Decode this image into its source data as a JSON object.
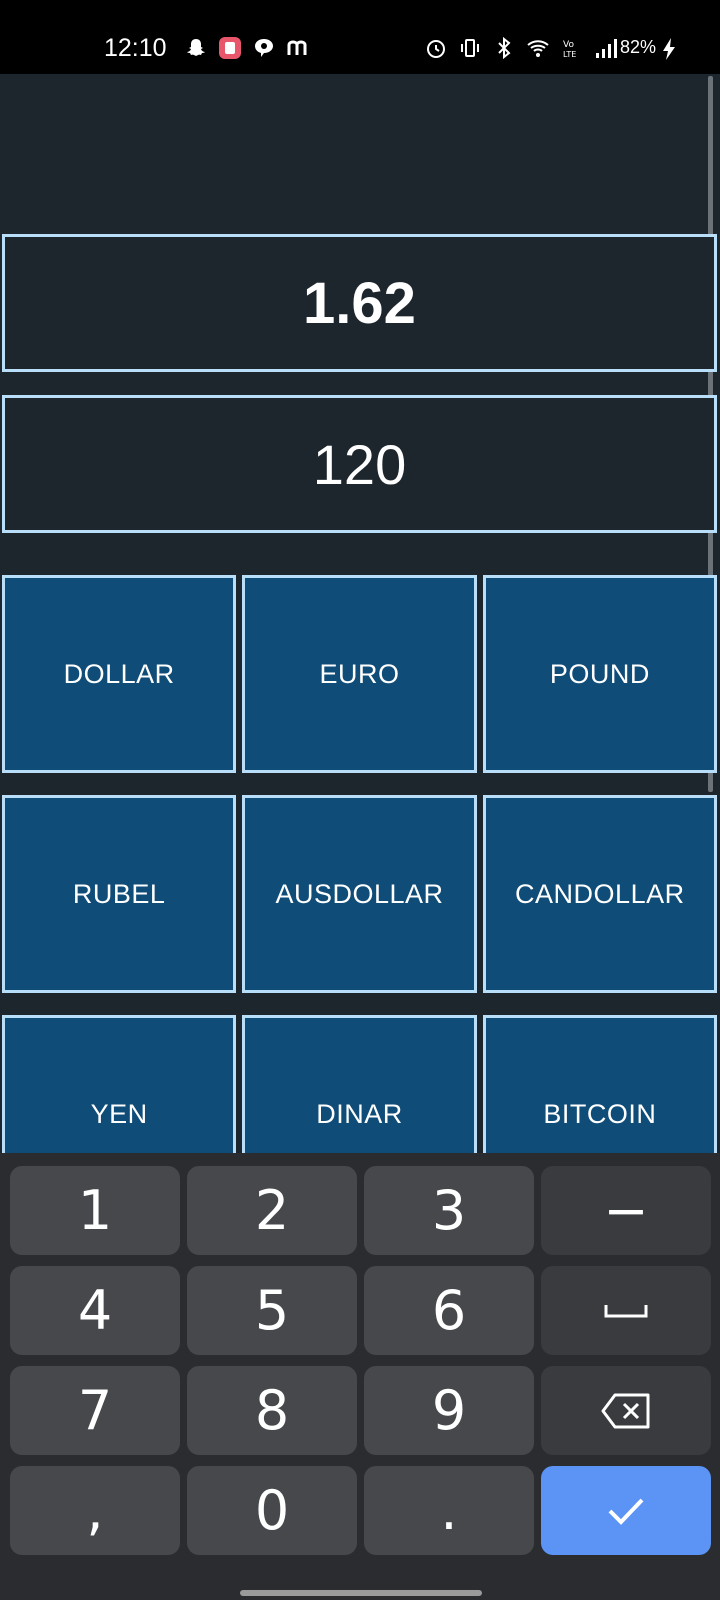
{
  "status_bar": {
    "time": "12:10",
    "battery": "82%",
    "left_icons": [
      "snapchat-icon",
      "app-icon",
      "chat-icon",
      "m-icon"
    ],
    "right_icons": [
      "alarm-icon",
      "vibrate-icon",
      "bluetooth-icon",
      "wifi-icon",
      "volte-icon",
      "signal-icon"
    ]
  },
  "display": {
    "result": "1.62",
    "input": "120"
  },
  "currencies": {
    "row1": [
      "DOLLAR",
      "EURO",
      "POUND"
    ],
    "row2": [
      "RUBEL",
      "AUSDOLLAR",
      "CANDOLLAR"
    ],
    "row3": [
      "YEN",
      "DINAR",
      "BITCOIN"
    ]
  },
  "keypad": {
    "k1": "1",
    "k2": "2",
    "k3": "3",
    "minus": "−",
    "k4": "4",
    "k5": "5",
    "k6": "6",
    "space": "space-icon",
    "k7": "7",
    "k8": "8",
    "k9": "9",
    "backspace": "backspace-icon",
    "comma": ",",
    "k0": "0",
    "dot": ".",
    "done": "check-icon"
  },
  "colors": {
    "background": "#1e262d",
    "border": "#b8defa",
    "button": "#0f4c78",
    "keypad_bg": "#2a2c2f",
    "key": "#46484b",
    "done_key": "#5c94f5"
  }
}
